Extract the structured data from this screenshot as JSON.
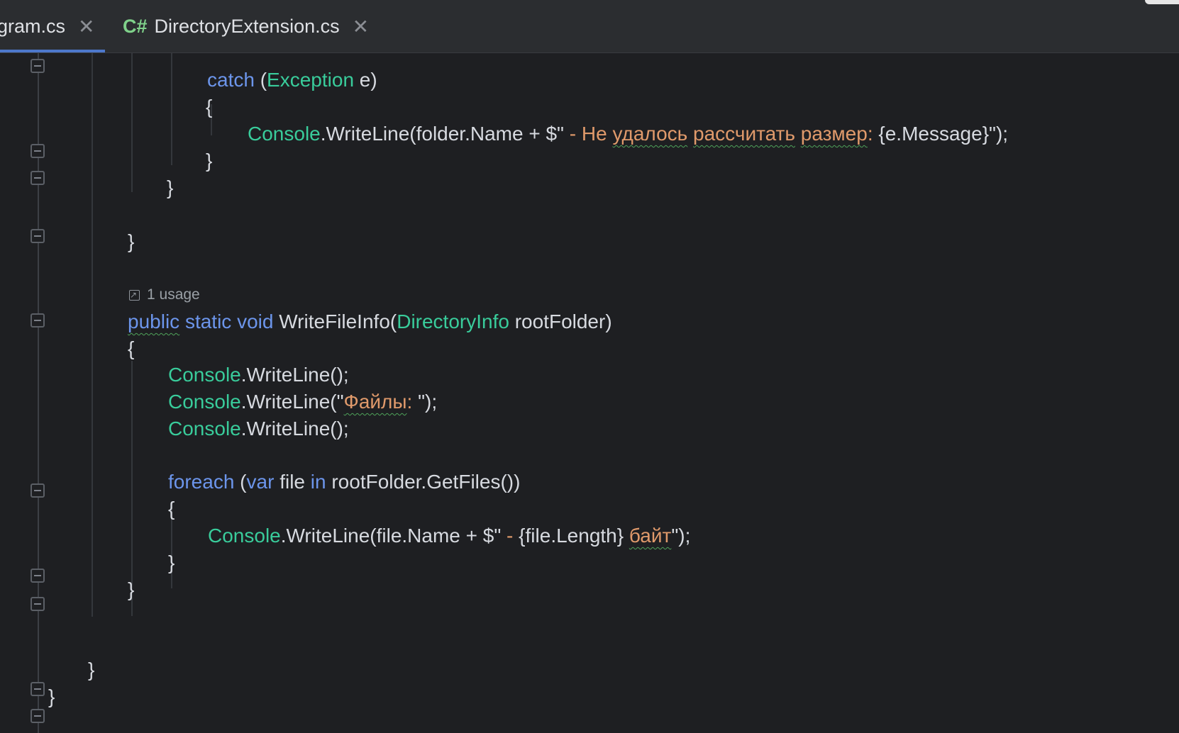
{
  "tabs": [
    {
      "label": "gram.cs",
      "active": true,
      "close": "✕"
    },
    {
      "icon": "C#",
      "label": "DirectoryExtension.cs",
      "active": false,
      "close": "✕"
    }
  ],
  "code": {
    "catch_kw": "catch",
    "catch_open": " (",
    "exception_type": "Exception",
    "catch_var": " e)",
    "brace_open": "{",
    "brace_close": "}",
    "console": "Console",
    "wl_folder_a": ".WriteLine(folder.Name + $\"",
    "wl_folder_str_a": " - Не ",
    "wl_folder_w1": "удалось",
    "wl_folder_w2": "рассчитать",
    "wl_folder_w3": "размер",
    "wl_folder_str_b": ": ",
    "wl_folder_b": "{e.Message}\");",
    "usage_text": "1 usage",
    "public_kw": "public",
    "static_kw": "static",
    "void_kw": "void",
    "method_name": "WriteFileInfo(",
    "dirinfo_type": "DirectoryInfo",
    "param": " rootFolder)",
    "wl_empty": ".WriteLine();",
    "wl_files_a": ".WriteLine(\"",
    "wl_files_str": "Файлы",
    "wl_files_str2": ": ",
    "wl_files_b": "\");",
    "foreach_kw": "foreach",
    "foreach_open": " (",
    "var_kw": "var",
    "foreach_file": " file ",
    "in_kw": "in",
    "foreach_rest": " rootFolder.GetFiles())",
    "wl_file_a": ".WriteLine(file.Name + $\"",
    "wl_file_str_a": " - ",
    "wl_file_b": "{file.Length}",
    "wl_file_str_b": " ",
    "wl_file_word": "байт",
    "wl_file_c": "\");"
  }
}
